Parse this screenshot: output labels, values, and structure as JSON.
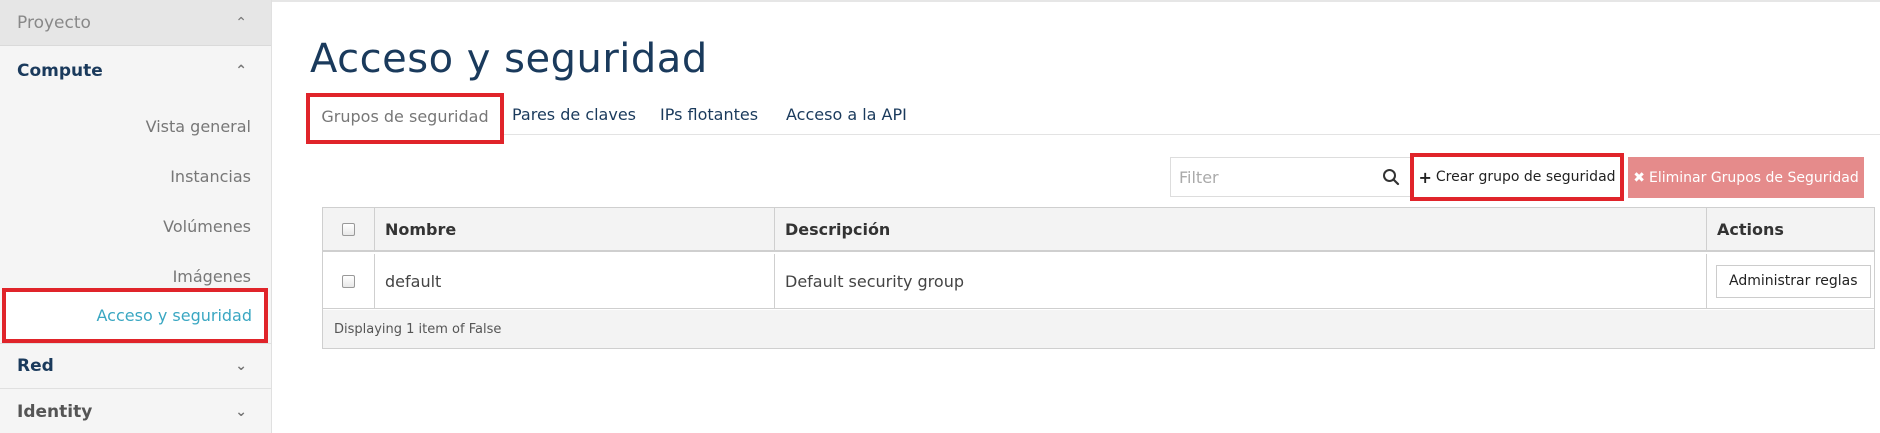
{
  "sidebar": {
    "proyecto": "Proyecto",
    "compute": "Compute",
    "items": [
      {
        "label": "Vista general"
      },
      {
        "label": "Instancias"
      },
      {
        "label": "Volúmenes"
      },
      {
        "label": "Imágenes"
      },
      {
        "label": "Acceso y seguridad"
      }
    ],
    "red": "Red",
    "identity": "Identity"
  },
  "page": {
    "title": "Acceso y seguridad"
  },
  "tabs": [
    {
      "label": "Grupos de seguridad"
    },
    {
      "label": "Pares de claves"
    },
    {
      "label": "IPs flotantes"
    },
    {
      "label": "Acceso a la API"
    }
  ],
  "toolbar": {
    "filter_placeholder": "Filter",
    "create_label": "Crear grupo de seguridad",
    "delete_label": "Eliminar Grupos de Seguridad"
  },
  "table": {
    "headers": {
      "name": "Nombre",
      "description": "Descripción",
      "actions": "Actions"
    },
    "rows": [
      {
        "name": "default",
        "description": "Default security group",
        "action": "Administrar reglas"
      }
    ],
    "footer": "Displaying 1 item of False"
  },
  "colors": {
    "accent": "#1a3a5c",
    "active_link": "#3aa7c2",
    "highlight": "#e0242a",
    "danger": "#e58b8b"
  }
}
